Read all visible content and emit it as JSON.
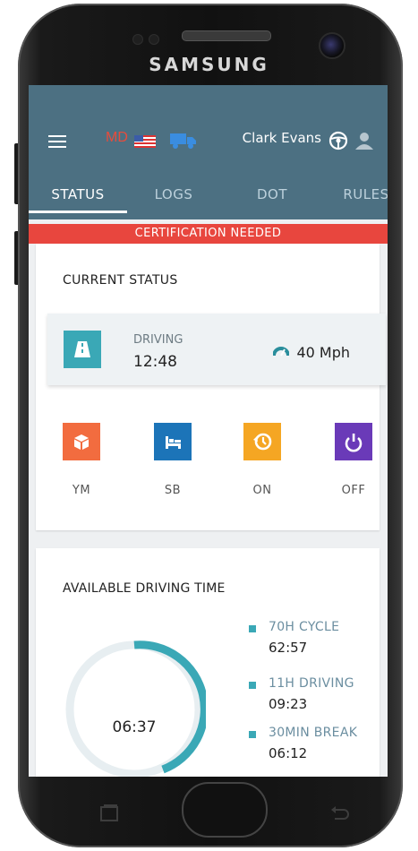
{
  "device": {
    "brand": "SAMSUNG"
  },
  "header": {
    "region_code": "MD",
    "user_name": "Clark Evans"
  },
  "tabs": [
    {
      "label": "STATUS",
      "active": true
    },
    {
      "label": "LOGS",
      "active": false
    },
    {
      "label": "DOT",
      "active": false
    },
    {
      "label": "RULES",
      "active": false
    }
  ],
  "banner": {
    "text": "CERTIFICATION NEEDED",
    "color": "#e8463e"
  },
  "current_status": {
    "title": "CURRENT STATUS",
    "mode_label": "DRIVING",
    "mode_time": "12:48",
    "speed": "40 Mph",
    "buttons": [
      {
        "label": "YM",
        "icon": "cube-icon",
        "color": "#f26c3f"
      },
      {
        "label": "SB",
        "icon": "bed-icon",
        "color": "#1c74b8"
      },
      {
        "label": "ON",
        "icon": "history-icon",
        "color": "#f5a623"
      },
      {
        "label": "OFF",
        "icon": "power-icon",
        "color": "#6a3ab8"
      }
    ]
  },
  "available_time": {
    "title": "AVAILABLE DRIVING TIME",
    "donut_value": "06:37",
    "legend": [
      {
        "label": "70H CYCLE",
        "value": "62:57"
      },
      {
        "label": "11H DRIVING",
        "value": "09:23"
      },
      {
        "label": "30MIN BREAK",
        "value": "06:12"
      }
    ]
  },
  "colors": {
    "appbar": "#4c7082",
    "accent": "#3aa8b6"
  }
}
